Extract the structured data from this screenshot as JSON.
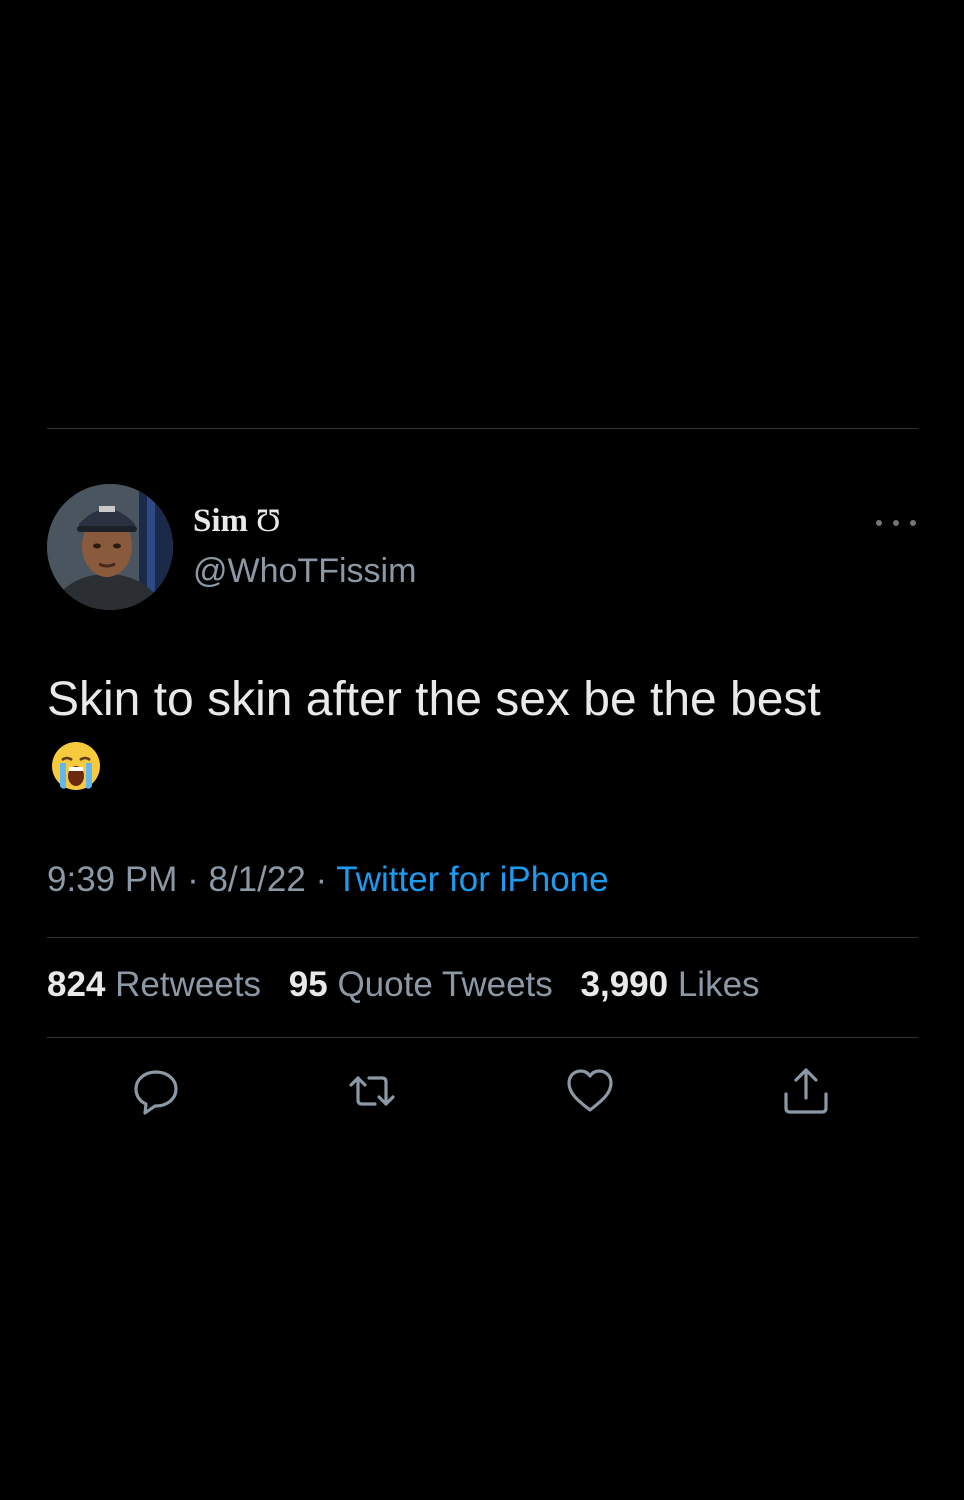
{
  "tweet": {
    "author": {
      "display_name": "Sim",
      "name_glyph": "Ʊ",
      "handle": "@WhoTFissim",
      "avatar_icon": "profile-photo"
    },
    "text": "Skin to skin after the sex be the best",
    "emoji": "loudly-crying-face",
    "time": "9:39 PM",
    "date": "8/1/22",
    "separator": " · ",
    "source": "Twitter for iPhone",
    "stats": {
      "retweets_count": "824",
      "retweets_label": "Retweets",
      "quotes_count": "95",
      "quotes_label": "Quote Tweets",
      "likes_count": "3,990",
      "likes_label": "Likes"
    },
    "actions": [
      "reply-icon",
      "retweet-icon",
      "like-icon",
      "share-icon"
    ]
  },
  "colors": {
    "background": "#000000",
    "text": "#e7e9ea",
    "secondary": "#8b98a5",
    "link": "#1d9bf0",
    "divider": "#2f3336"
  }
}
